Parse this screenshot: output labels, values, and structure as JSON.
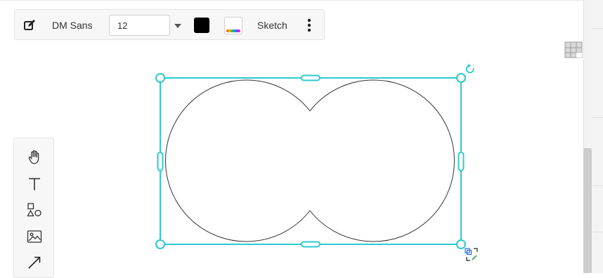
{
  "toolbar": {
    "edit_icon": "pencil-square-icon",
    "font_family": "DM Sans",
    "font_size": "12",
    "stroke_color": "#000000",
    "fill_icon": "rainbow-fill-icon",
    "mode": "Sketch",
    "more_icon": "kebab-menu-icon"
  },
  "tools": [
    {
      "name": "hand-icon"
    },
    {
      "name": "text-icon"
    },
    {
      "name": "shapes-icon"
    },
    {
      "name": "image-icon"
    },
    {
      "name": "arrow-icon"
    }
  ],
  "colors": {
    "selection": "#2ccad0",
    "shape_stroke": "#333333"
  }
}
